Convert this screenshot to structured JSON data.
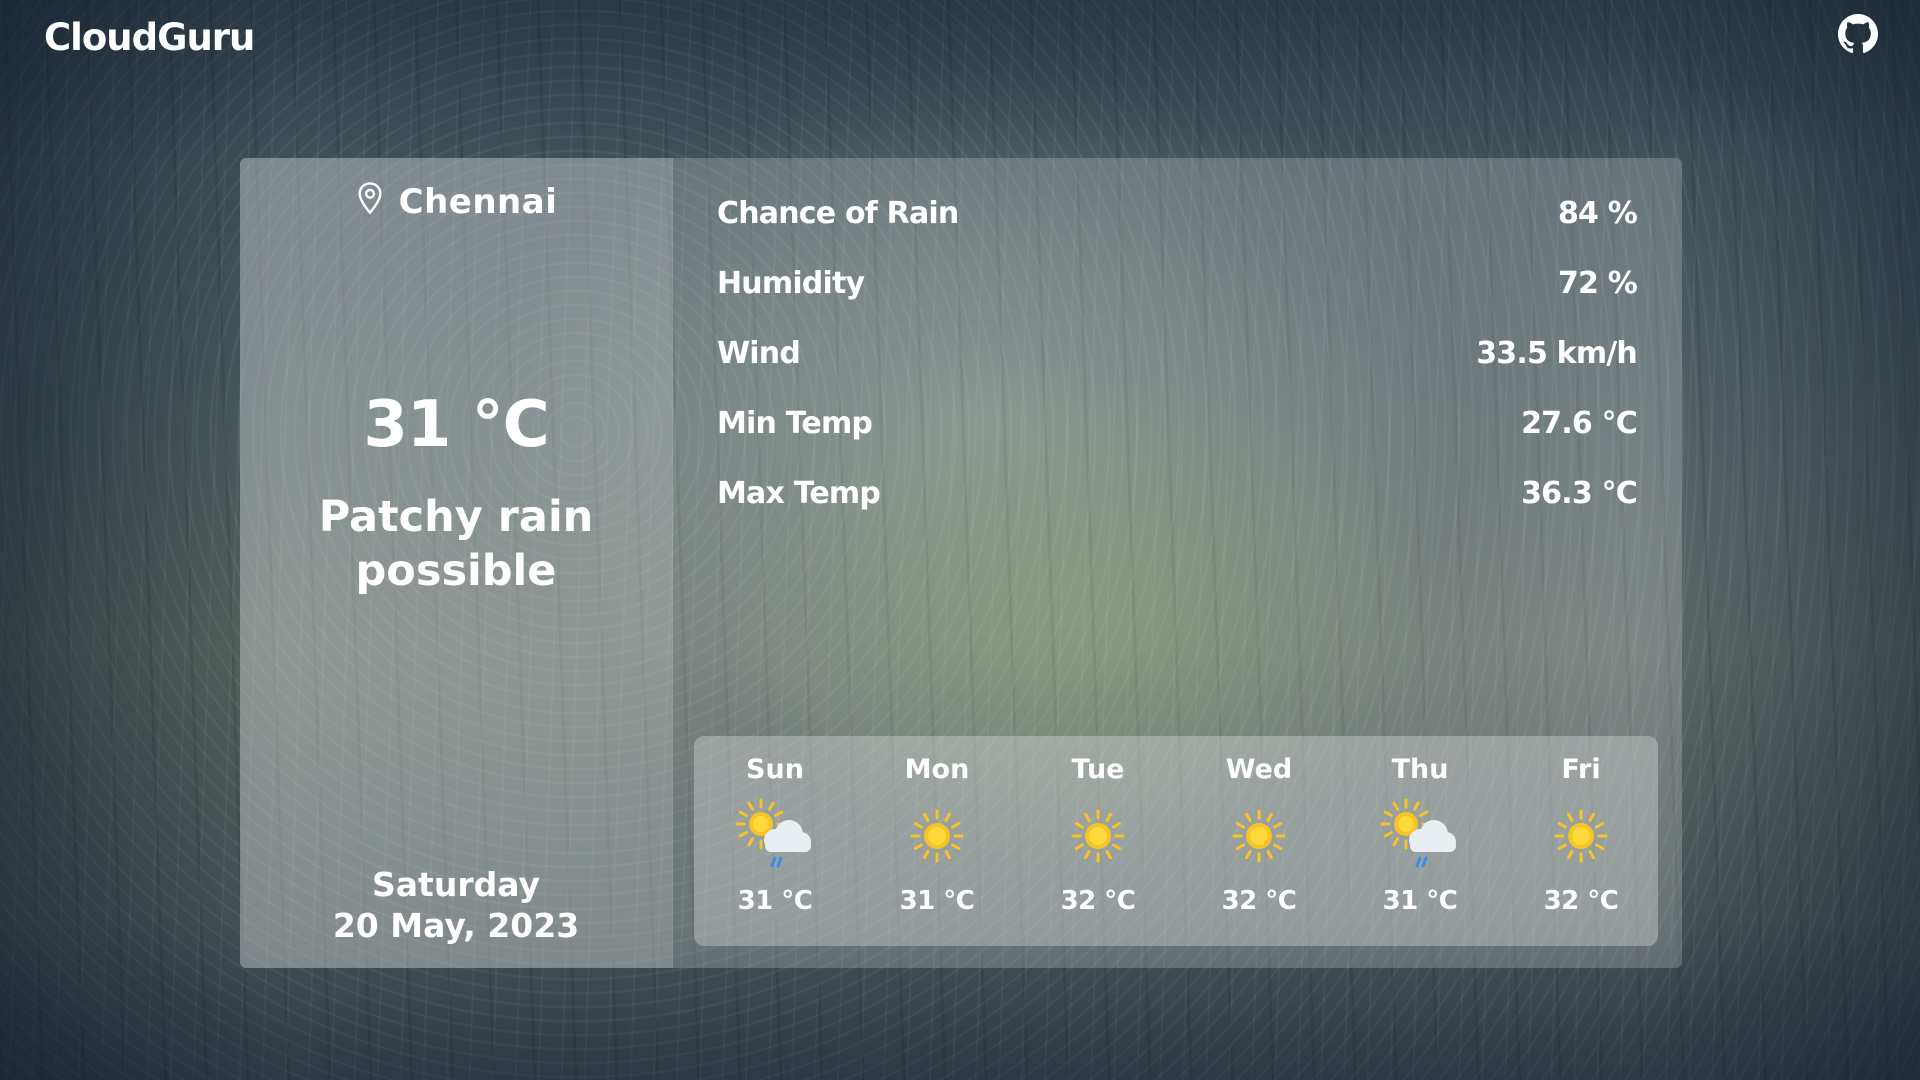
{
  "app": {
    "brand": "CloudGuru"
  },
  "colors": {
    "sun": "#f7c325",
    "sun_core": "#ffd83a",
    "cloud": "#e8eef2",
    "rain": "#3a8ee6"
  },
  "current": {
    "location": "Chennai",
    "temperature": "31 °C",
    "condition": "Patchy rain possible",
    "day": "Saturday",
    "date": "20 May, 2023"
  },
  "stats": [
    {
      "label": "Chance of Rain",
      "value": "84 %"
    },
    {
      "label": "Humidity",
      "value": "72 %"
    },
    {
      "label": "Wind",
      "value": "33.5 km/h"
    },
    {
      "label": "Min Temp",
      "value": "27.6 °C"
    },
    {
      "label": "Max Temp",
      "value": "36.3 °C"
    }
  ],
  "forecast": [
    {
      "day": "Sun",
      "temp": "31 °C",
      "icon": "patchy-rain-icon"
    },
    {
      "day": "Mon",
      "temp": "31 °C",
      "icon": "sunny-icon"
    },
    {
      "day": "Tue",
      "temp": "32 °C",
      "icon": "sunny-icon"
    },
    {
      "day": "Wed",
      "temp": "32 °C",
      "icon": "sunny-icon"
    },
    {
      "day": "Thu",
      "temp": "31 °C",
      "icon": "patchy-rain-icon"
    },
    {
      "day": "Fri",
      "temp": "32 °C",
      "icon": "sunny-icon"
    }
  ]
}
